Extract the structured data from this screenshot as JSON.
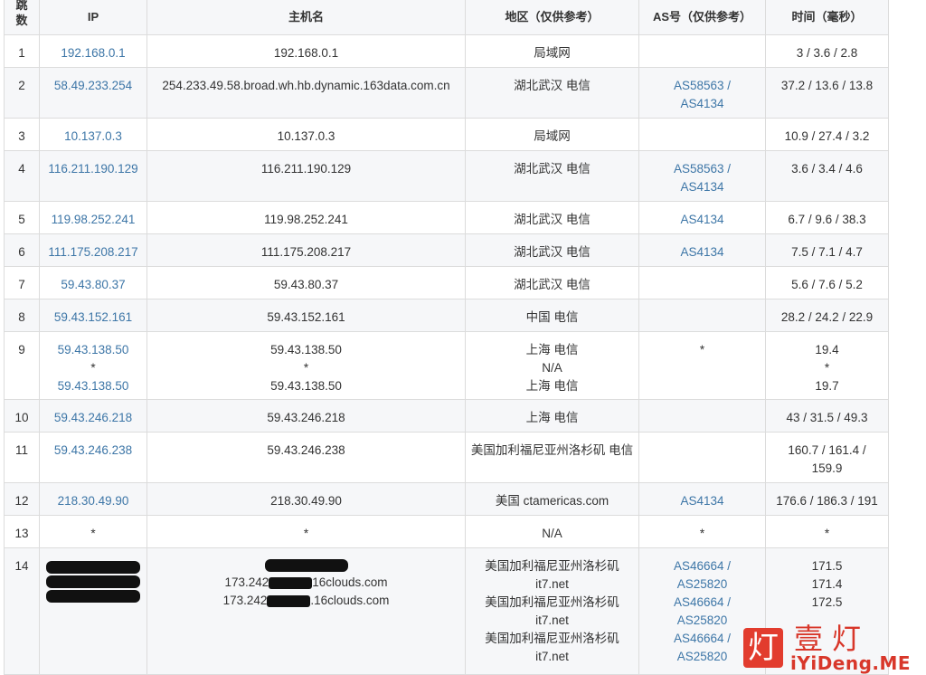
{
  "headers": {
    "hop": [
      "跳",
      "数"
    ],
    "ip": "IP",
    "host": "主机名",
    "region": "地区（仅供参考）",
    "as": "AS号（仅供参考）",
    "time": "时间（毫秒）"
  },
  "rows": [
    {
      "hop": "1",
      "ip": [
        "192.168.0.1"
      ],
      "host": [
        "192.168.0.1"
      ],
      "region": [
        "局域网"
      ],
      "as": [],
      "time": [
        "3 / 3.6 / 2.8"
      ]
    },
    {
      "hop": "2",
      "ip": [
        "58.49.233.254"
      ],
      "host": [
        "254.233.49.58.broad.wh.hb.dynamic.163data.com.cn"
      ],
      "region": [
        "湖北武汉 电信"
      ],
      "as": [
        "AS58563 /",
        "AS4134"
      ],
      "time": [
        "37.2 / 13.6 / 13.8"
      ]
    },
    {
      "hop": "3",
      "ip": [
        "10.137.0.3"
      ],
      "host": [
        "10.137.0.3"
      ],
      "region": [
        "局域网"
      ],
      "as": [],
      "time": [
        "10.9 / 27.4 / 3.2"
      ]
    },
    {
      "hop": "4",
      "ip": [
        "116.211.190.129"
      ],
      "host": [
        "116.211.190.129"
      ],
      "region": [
        "湖北武汉 电信"
      ],
      "as": [
        "AS58563 /",
        "AS4134"
      ],
      "time": [
        "3.6 / 3.4 / 4.6"
      ]
    },
    {
      "hop": "5",
      "ip": [
        "119.98.252.241"
      ],
      "host": [
        "119.98.252.241"
      ],
      "region": [
        "湖北武汉 电信"
      ],
      "as": [
        "AS4134"
      ],
      "time": [
        "6.7 / 9.6 / 38.3"
      ]
    },
    {
      "hop": "6",
      "ip": [
        "111.175.208.217"
      ],
      "host": [
        "111.175.208.217"
      ],
      "region": [
        "湖北武汉 电信"
      ],
      "as": [
        "AS4134"
      ],
      "time": [
        "7.5 / 7.1 / 4.7"
      ]
    },
    {
      "hop": "7",
      "ip": [
        "59.43.80.37"
      ],
      "host": [
        "59.43.80.37"
      ],
      "region": [
        "湖北武汉 电信"
      ],
      "as": [],
      "time": [
        "5.6 / 7.6 / 5.2"
      ]
    },
    {
      "hop": "8",
      "ip": [
        "59.43.152.161"
      ],
      "host": [
        "59.43.152.161"
      ],
      "region": [
        "中国 电信"
      ],
      "as": [],
      "time": [
        "28.2 / 24.2 / 22.9"
      ]
    },
    {
      "hop": "9",
      "ip": [
        "59.43.138.50",
        "*",
        "59.43.138.50"
      ],
      "host": [
        "59.43.138.50",
        "*",
        "59.43.138.50"
      ],
      "region": [
        "上海 电信",
        "N/A",
        "上海 电信"
      ],
      "as": [
        "*"
      ],
      "time": [
        "19.4",
        "*",
        "19.7"
      ]
    },
    {
      "hop": "10",
      "ip": [
        "59.43.246.218"
      ],
      "host": [
        "59.43.246.218"
      ],
      "region": [
        "上海 电信"
      ],
      "as": [],
      "time": [
        "43 / 31.5 / 49.3"
      ]
    },
    {
      "hop": "11",
      "ip": [
        "59.43.246.238"
      ],
      "host": [
        "59.43.246.238"
      ],
      "region": [
        "美国加利福尼亚州洛杉矶 电信"
      ],
      "as": [],
      "time": [
        "160.7 / 161.4 /",
        "159.9"
      ]
    },
    {
      "hop": "12",
      "ip": [
        "218.30.49.90"
      ],
      "host": [
        "218.30.49.90"
      ],
      "region": [
        "美国 ctamericas.com"
      ],
      "as": [
        "AS4134"
      ],
      "time": [
        "176.6 / 186.3 / 191"
      ]
    },
    {
      "hop": "13",
      "ip": [
        "*"
      ],
      "host": [
        "*"
      ],
      "region": [
        "N/A"
      ],
      "as": [
        "*"
      ],
      "time": [
        "*"
      ]
    },
    {
      "hop": "14",
      "ip": [],
      "host": [
        "173.242",
        "16clouds.com",
        "173.242",
        ".16clouds.com"
      ],
      "region": [
        "美国加利福尼亚州洛杉矶",
        "it7.net",
        "美国加利福尼亚州洛杉矶",
        "it7.net",
        "美国加利福尼亚州洛杉矶",
        "it7.net"
      ],
      "as": [
        "AS46664 /",
        "AS25820",
        "AS46664 /",
        "AS25820",
        "AS46664 /",
        "AS25820"
      ],
      "time": [
        "171.5",
        "171.4",
        "172.5"
      ]
    }
  ],
  "watermark": {
    "icon_char": "灯",
    "cn_text": "壹灯",
    "en_text": "iYiDeng.ME"
  },
  "colors": {
    "link": "#3d76a7",
    "zebra": "#f6f7f9",
    "border": "#dcdcdc",
    "watermark": "#d8372a"
  }
}
